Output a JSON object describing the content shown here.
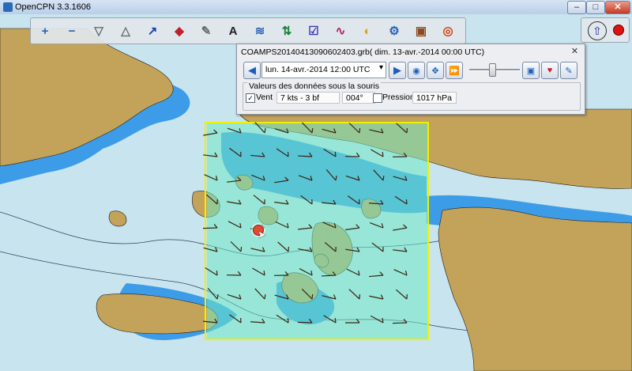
{
  "window": {
    "title": "OpenCPN 3.3.1606",
    "minimize": "–",
    "maximize": "□",
    "close": "✕"
  },
  "toolbar": {
    "items": [
      {
        "name": "zoom-in",
        "glyph": "+"
      },
      {
        "name": "zoom-out",
        "glyph": "−"
      },
      {
        "name": "scale-in",
        "glyph": "▽"
      },
      {
        "name": "scale-out",
        "glyph": "△"
      },
      {
        "name": "route",
        "glyph": "↗"
      },
      {
        "name": "auto-follow",
        "glyph": "◆"
      },
      {
        "name": "settings",
        "glyph": "✎"
      },
      {
        "name": "text",
        "glyph": "A"
      },
      {
        "name": "current",
        "glyph": "≋"
      },
      {
        "name": "tide",
        "glyph": "⇅"
      },
      {
        "name": "route-manager",
        "glyph": "☑"
      },
      {
        "name": "track",
        "glyph": "∿"
      },
      {
        "name": "color-scheme",
        "glyph": "◐"
      },
      {
        "name": "grib",
        "glyph": "⚙"
      },
      {
        "name": "print",
        "glyph": "▣"
      },
      {
        "name": "help",
        "glyph": "◎"
      }
    ]
  },
  "grib": {
    "header": "COAMPS20140413090602403.grb( dim. 13-avr.-2014 00:00  UTC)",
    "close": "✕",
    "date_value": "lun. 14-avr.-2014 12:00  UTC",
    "section_label": "Valeurs des données sous la souris",
    "wind_label": "Vent",
    "wind_speed": "7 kts -  3 bf",
    "wind_direction": "004°",
    "pressure_label": "Pression",
    "pressure_value": "1017 hPa",
    "wind_checked": "✓"
  },
  "colors": {
    "sea": "#c8e4ee",
    "shallow": "#3d9ce8",
    "land": "#c3a25a",
    "grib_overlay": "#6fe7c4",
    "frame": "#f0f000"
  }
}
